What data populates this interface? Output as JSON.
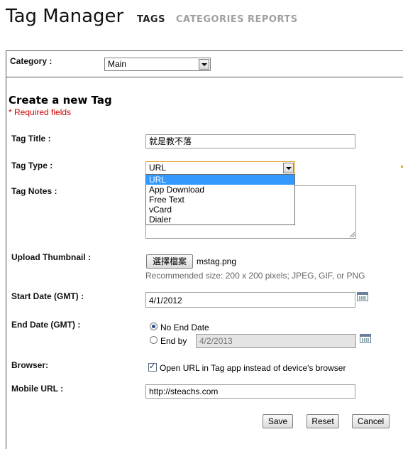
{
  "header": {
    "app_title": "Tag Manager",
    "tabs": [
      "TAGS",
      "CATEGORIES",
      "REPORTS"
    ]
  },
  "category": {
    "label": "Category :",
    "value": "Main"
  },
  "form": {
    "heading": "Create a new Tag",
    "required_note": "* Required fields",
    "tag_title": {
      "label": "Tag Title :",
      "value": "就是教不落"
    },
    "tag_type": {
      "label": "Tag Type :",
      "value": "URL",
      "options": [
        "URL",
        "App Download",
        "Free Text",
        "vCard",
        "Dialer"
      ]
    },
    "tag_notes": {
      "label": "Tag Notes :",
      "value": ""
    },
    "thumbnail": {
      "label": "Upload Thumbnail :",
      "button": "選擇檔案",
      "filename": "mstag.png",
      "hint": "Recommended size: 200 x 200 pixels; JPEG, GIF, or PNG"
    },
    "start_date": {
      "label": "Start Date (GMT) :",
      "value": "4/1/2012"
    },
    "end_date": {
      "label": "End Date (GMT) :",
      "no_end_label": "No End Date",
      "end_by_label": "End by",
      "value": "4/2/2013"
    },
    "browser": {
      "label": "Browser:",
      "checkbox_label": "Open URL in Tag app instead of device's browser"
    },
    "mobile_url": {
      "label": "Mobile URL :",
      "value": "http://steachs.com"
    },
    "actions": {
      "save": "Save",
      "reset": "Reset",
      "cancel": "Cancel"
    }
  },
  "colors": {
    "required": "#cc0000",
    "selection": "#3399ff",
    "focus_border": "#e0a02c",
    "inactive_tab": "#a0a0a0"
  }
}
